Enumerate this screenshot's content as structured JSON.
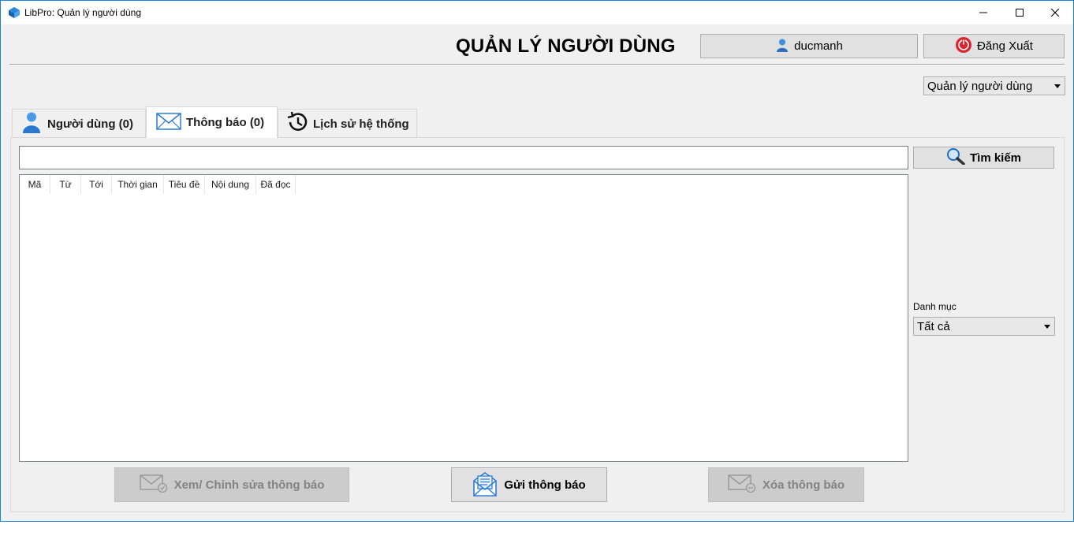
{
  "window": {
    "title": "LibPro: Quản lý người dùng"
  },
  "header": {
    "title": "QUẢN LÝ NGƯỜI DÙNG",
    "username": "ducmanh",
    "logout_label": "Đăng Xuất"
  },
  "view_selector": {
    "selected": "Quản lý người dùng"
  },
  "tabs": [
    {
      "label": "Người dùng (0)",
      "icon": "user-icon"
    },
    {
      "label": "Thông báo (0)",
      "icon": "envelope-icon",
      "active": true
    },
    {
      "label": "Lịch sử hệ thống",
      "icon": "history-icon"
    }
  ],
  "search": {
    "value": "",
    "button_label": "Tìm kiếm"
  },
  "table": {
    "columns": [
      "Mã",
      "Từ",
      "Tới",
      "Thời gian",
      "Tiêu đề",
      "Nội dung",
      "Đã đọc"
    ],
    "rows": []
  },
  "category": {
    "label": "Danh mục",
    "selected": "Tất cả"
  },
  "actions": {
    "edit_label": "Xem/ Chỉnh sửa thông báo",
    "send_label": "Gửi thông báo",
    "delete_label": "Xóa thông báo"
  },
  "colors": {
    "window_border": "#1883d7",
    "accent_blue": "#2b7bd6",
    "logout_red": "#d9262e",
    "disabled_bg": "#cccccc"
  }
}
